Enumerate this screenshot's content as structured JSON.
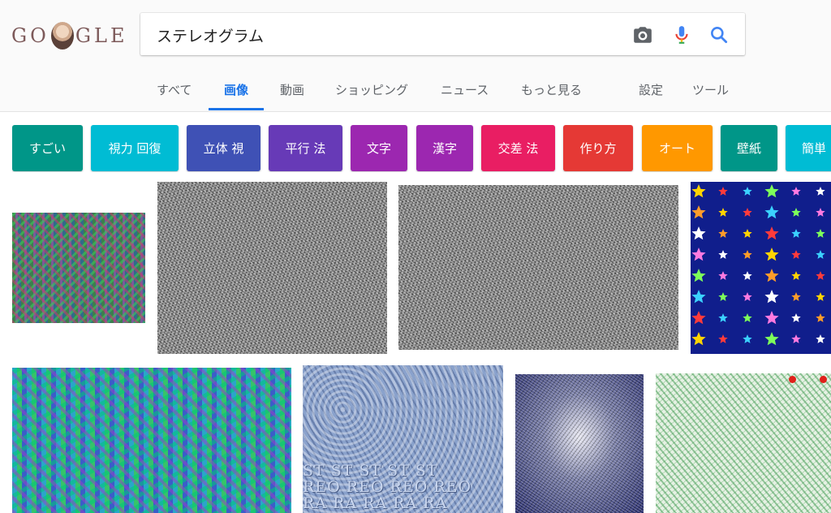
{
  "logo": {
    "text_left": "GO",
    "text_right": "GLE",
    "icon": "doodle-portrait"
  },
  "search": {
    "query": "ステレオグラム",
    "camera_icon": "camera-icon",
    "mic_icon": "mic-icon",
    "search_icon": "search-icon"
  },
  "nav": {
    "tabs": [
      "すべて",
      "画像",
      "動画",
      "ショッピング",
      "ニュース",
      "もっと見る"
    ],
    "active_tab": "画像",
    "settings": "設定",
    "tools": "ツール"
  },
  "chips": [
    {
      "label": "すごい",
      "color": "#009688"
    },
    {
      "label": "視力 回復",
      "color": "#00bcd4"
    },
    {
      "label": "立体 視",
      "color": "#3f51b5"
    },
    {
      "label": "平行 法",
      "color": "#673ab7"
    },
    {
      "label": "文字",
      "color": "#9c27b0"
    },
    {
      "label": "漢字",
      "color": "#9c27b0"
    },
    {
      "label": "交差 法",
      "color": "#e91e63"
    },
    {
      "label": "作り方",
      "color": "#e53935"
    },
    {
      "label": "オート",
      "color": "#ff9800"
    },
    {
      "label": "壁紙",
      "color": "#009688"
    },
    {
      "label": "簡単",
      "color": "#00bcd4"
    }
  ],
  "results": {
    "thumb6_letters_row1": "ST  ST  ST  ST  ST",
    "thumb6_letters_row2": "REO REO REO REO",
    "thumb6_letters_row3": "RA  RA  RA  RA  RA"
  }
}
